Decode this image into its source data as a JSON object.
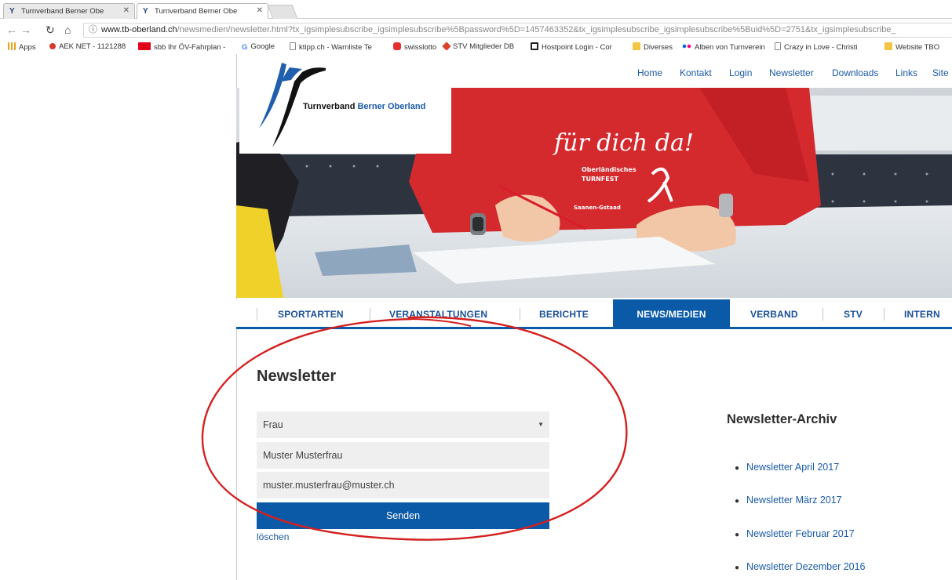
{
  "browser": {
    "tabs": [
      {
        "title": "Turnverband Berner Obe",
        "active": false
      },
      {
        "title": "Turnverband Berner Obe",
        "active": true
      }
    ],
    "url_host": "www.tb-oberland.ch",
    "url_rest": "/newsmedien/newsletter.html?tx_igsimplesubscribe_igsimplesubscribe%5Bpassword%5D=1457463352&tx_igsimplesubscribe_igsimplesubscribe%5Buid%5D=2751&tx_igsimplesubscribe_",
    "bookmarks": [
      {
        "label": "Apps",
        "color": "#e8a21c"
      },
      {
        "label": "AEK NET - 1121288",
        "color": "#d33a2c"
      },
      {
        "label": "sbb Ihr ÖV-Fahrplan -",
        "color": "#e2001a"
      },
      {
        "label": "Google",
        "color": "#4285f4"
      },
      {
        "label": "ktipp.ch - Warnliste Te",
        "color": "#9e9e9e"
      },
      {
        "label": "swisslotto",
        "color": "#e63030"
      },
      {
        "label": "STV Mitglieder DB",
        "color": "#d8432a"
      },
      {
        "label": "Hostpoint Login - Cor",
        "color": "#222222"
      },
      {
        "label": "Diverses",
        "color": "#f4c542"
      },
      {
        "label": "Alben von Turnverein",
        "color": "#e03a7a"
      },
      {
        "label": "Crazy in Love - Christi",
        "color": "#9e9e9e"
      },
      {
        "label": "Website TBO",
        "color": "#f4c542"
      }
    ]
  },
  "site": {
    "logo_text_1": "Turnverband",
    "logo_text_2": "Berner Oberland",
    "top_nav": [
      "Home",
      "Kontakt",
      "Login",
      "Newsletter",
      "Downloads",
      "Links",
      "Site"
    ],
    "hero_shirt_text": "für dich da!",
    "hero_shirt_small_1": "Oberländisches",
    "hero_shirt_small_2": "TURNFEST",
    "hero_shirt_small_3": "Saanen-Gstaad",
    "main_nav": [
      "SPORTARTEN",
      "VERANSTALTUNGEN",
      "BERICHTE",
      "NEWS/MEDIEN",
      "VERBAND",
      "STV",
      "INTERN"
    ],
    "main_nav_active": "NEWS/MEDIEN"
  },
  "form": {
    "heading": "Newsletter",
    "salutation": "Frau",
    "name_value": "Muster Musterfrau",
    "email_value": "muster.musterfrau@muster.ch",
    "submit_label": "Senden",
    "clear_label": "löschen"
  },
  "archive": {
    "title": "Newsletter-Archiv",
    "items": [
      "Newsletter April 2017",
      "Newsletter März 2017",
      "Newsletter Februar 2017",
      "Newsletter Dezember 2016"
    ]
  },
  "colors": {
    "brand_blue": "#0a5aa8",
    "annotation_red": "#d42020"
  }
}
